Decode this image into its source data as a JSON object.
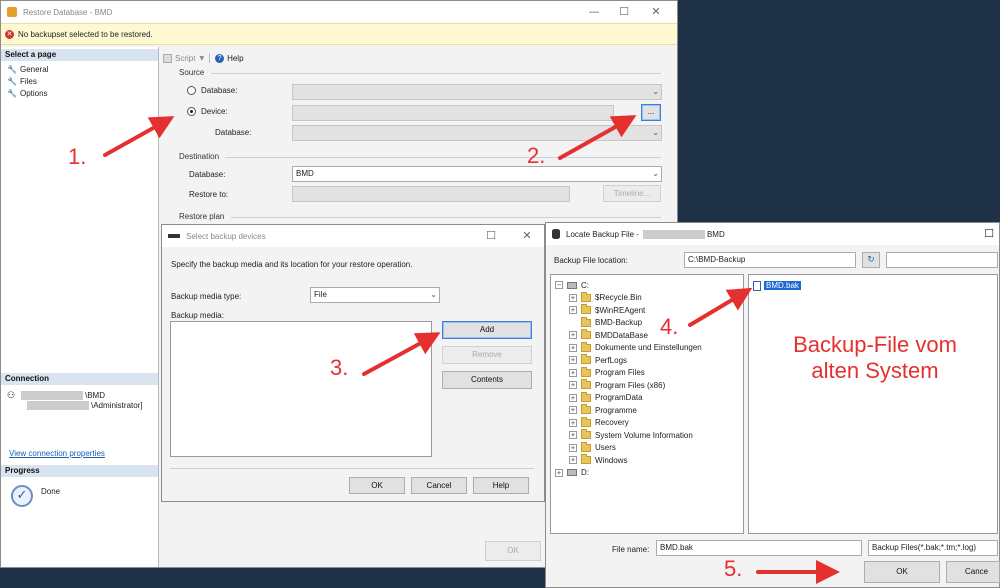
{
  "restore_window": {
    "title": "Restore Database - BMD",
    "error_message": "No backupset selected to be restored.",
    "select_page_header": "Select a page",
    "pages": [
      {
        "label": "General",
        "icon": "wrench-icon"
      },
      {
        "label": "Files",
        "icon": "wrench-icon"
      },
      {
        "label": "Options",
        "icon": "wrench-icon"
      }
    ],
    "toolbar": {
      "script_label": "Script",
      "help_label": "Help"
    },
    "source": {
      "label": "Source",
      "database_label": "Database:",
      "device_label": "Device:",
      "device_browse_label": "...",
      "device_database_label": "Database:"
    },
    "destination": {
      "label": "Destination",
      "database_label": "Database:",
      "database_value": "BMD",
      "restore_to_label": "Restore to:",
      "timeline_label": "Timeline..."
    },
    "restore_plan_label": "Restore plan",
    "connection": {
      "header": "Connection",
      "server": "\\BMD",
      "user": "\\Administrator]",
      "view_properties_link": "View connection properties"
    },
    "progress": {
      "header": "Progress",
      "status": "Done"
    },
    "ok_label": "OK"
  },
  "select_devices_dialog": {
    "title": "Select backup devices",
    "description": "Specify the backup media and its location for your restore operation.",
    "media_type_label": "Backup media type:",
    "media_type_value": "File",
    "media_label": "Backup media:",
    "add_label": "Add",
    "remove_label": "Remove",
    "contents_label": "Contents",
    "ok_label": "OK",
    "cancel_label": "Cancel",
    "help_label": "Help"
  },
  "locate_dialog": {
    "title_prefix": "Locate Backup File -",
    "title_suffix": "BMD",
    "location_label": "Backup File location:",
    "location_value": "C:\\BMD-Backup",
    "tree": [
      {
        "label": "C:",
        "level": 0,
        "expander": "−",
        "kind": "drive"
      },
      {
        "label": "$Recycle.Bin",
        "level": 1,
        "expander": "+",
        "kind": "folder"
      },
      {
        "label": "$WinREAgent",
        "level": 1,
        "expander": "+",
        "kind": "folder"
      },
      {
        "label": "BMD-Backup",
        "level": 1,
        "expander": "",
        "kind": "folder"
      },
      {
        "label": "BMDDataBase",
        "level": 1,
        "expander": "+",
        "kind": "folder"
      },
      {
        "label": "Dokumente und Einstellungen",
        "level": 1,
        "expander": "+",
        "kind": "folder"
      },
      {
        "label": "PerfLogs",
        "level": 1,
        "expander": "+",
        "kind": "folder"
      },
      {
        "label": "Program Files",
        "level": 1,
        "expander": "+",
        "kind": "folder"
      },
      {
        "label": "Program Files (x86)",
        "level": 1,
        "expander": "+",
        "kind": "folder"
      },
      {
        "label": "ProgramData",
        "level": 1,
        "expander": "+",
        "kind": "folder"
      },
      {
        "label": "Programme",
        "level": 1,
        "expander": "+",
        "kind": "folder"
      },
      {
        "label": "Recovery",
        "level": 1,
        "expander": "+",
        "kind": "folder"
      },
      {
        "label": "System Volume Information",
        "level": 1,
        "expander": "+",
        "kind": "folder"
      },
      {
        "label": "Users",
        "level": 1,
        "expander": "+",
        "kind": "folder"
      },
      {
        "label": "Windows",
        "level": 1,
        "expander": "+",
        "kind": "folder"
      },
      {
        "label": "D:",
        "level": 0,
        "expander": "+",
        "kind": "drive"
      }
    ],
    "selected_file": "BMD.bak",
    "file_name_label": "File name:",
    "file_name_value": "BMD.bak",
    "filter_value": "Backup Files(*.bak;*.tm;*.log)",
    "ok_label": "OK",
    "cancel_label": "Cance"
  },
  "annotations": {
    "step1": "1.",
    "step2": "2.",
    "step3": "3.",
    "step4": "4.",
    "step5": "5.",
    "backup_note_line1": "Backup-File vom",
    "backup_note_line2": "alten System",
    "color": "#e53030"
  }
}
